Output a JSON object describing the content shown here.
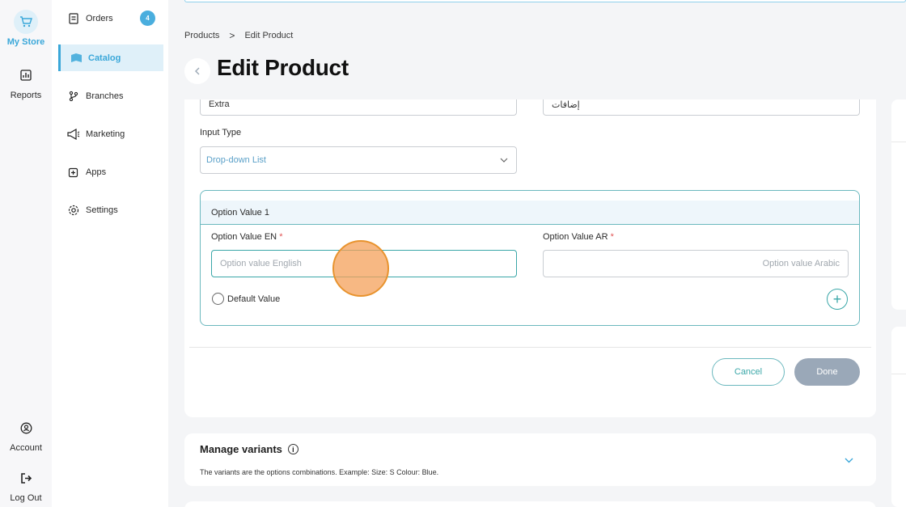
{
  "rail": {
    "store_label": "My Store",
    "reports_label": "Reports",
    "account_label": "Account",
    "logout_label": "Log Out"
  },
  "nav": {
    "items": [
      {
        "label": "Orders",
        "icon": "orders-icon",
        "badge": "4"
      },
      {
        "label": "Catalog",
        "icon": "catalog-icon"
      },
      {
        "label": "Branches",
        "icon": "branches-icon"
      },
      {
        "label": "Marketing",
        "icon": "megaphone-icon"
      },
      {
        "label": "Apps",
        "icon": "apps-icon"
      },
      {
        "label": "Settings",
        "icon": "gear-icon"
      }
    ]
  },
  "breadcrumb": {
    "parent": "Products",
    "separator": ">",
    "current": "Edit Product"
  },
  "page": {
    "title": "Edit Product"
  },
  "form": {
    "name_en_value": "Extra",
    "name_ar_value": "إضافات",
    "input_type_label": "Input Type",
    "input_type_value": "Drop-down List",
    "option_title": "Option Value 1",
    "option_en_label": "Option Value EN",
    "option_ar_label": "Option Value AR",
    "required_mark": "*",
    "option_en_placeholder": "Option value English",
    "option_ar_placeholder": "Option value Arabic",
    "default_value_label": "Default Value",
    "cancel_label": "Cancel",
    "done_label": "Done"
  },
  "variants": {
    "title": "Manage variants",
    "info": "i",
    "description": "The variants are the options combinations. Example: Size: S Colour: Blue."
  },
  "colors": {
    "accent": "#3aa7d9",
    "teal": "#3aa7a8",
    "done_disabled": "#9aa8b8",
    "cursor": "#f4a05a"
  }
}
